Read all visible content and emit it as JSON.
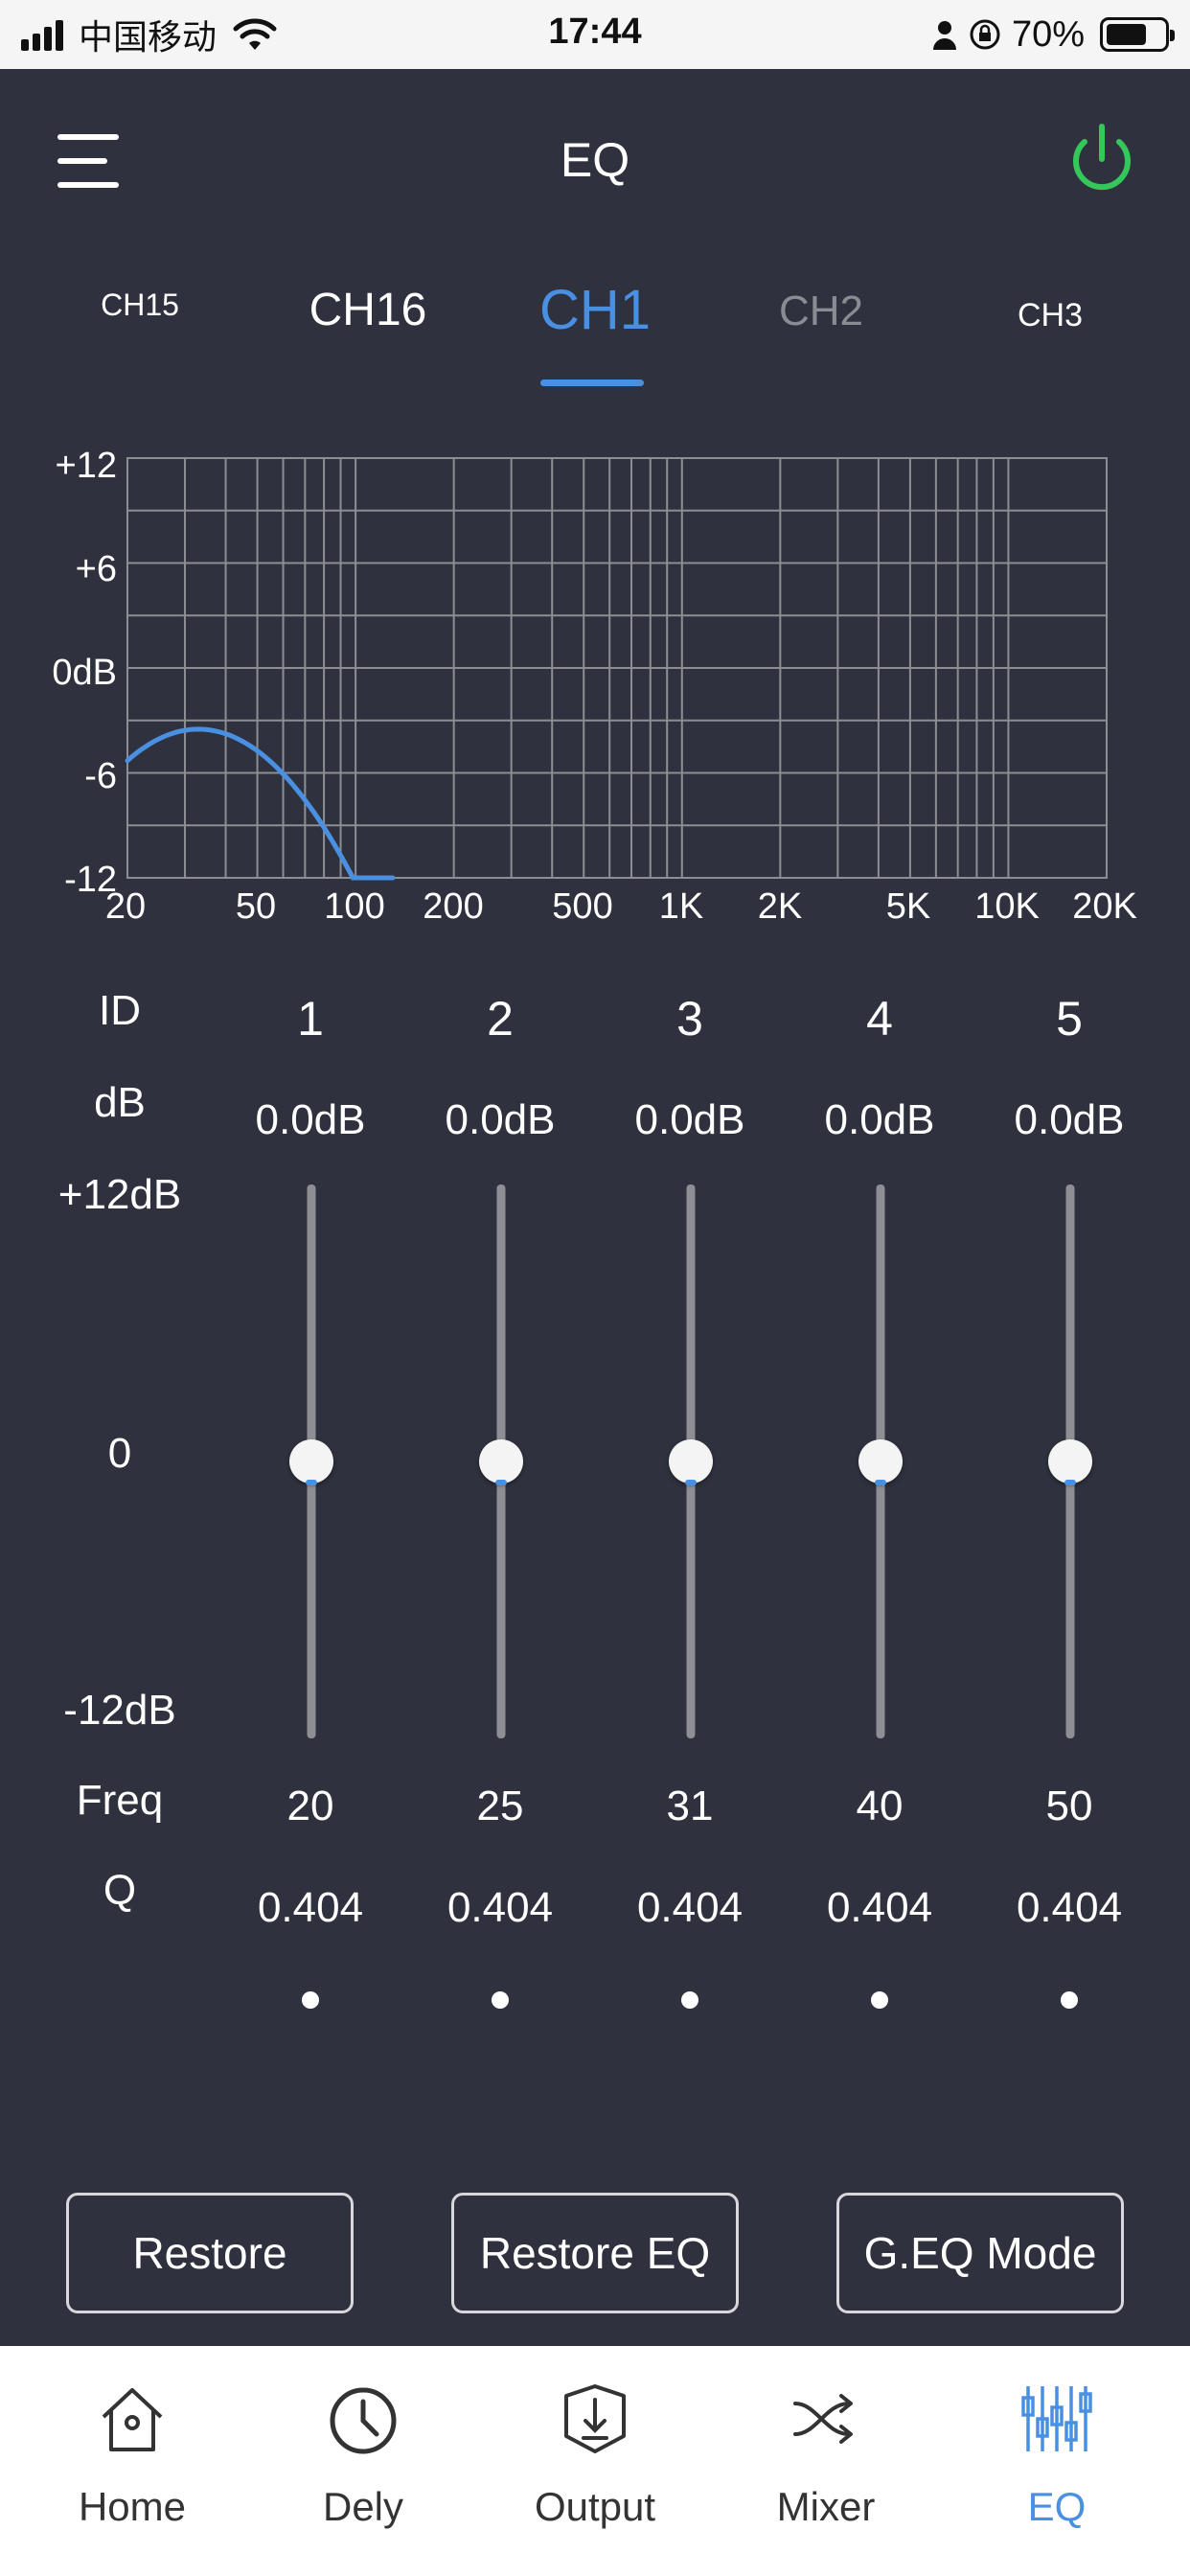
{
  "status_bar": {
    "carrier": "中国移动",
    "time": "17:44",
    "battery": "70%",
    "battery_level": 0.7,
    "signal_bars": 4
  },
  "header": {
    "title": "EQ",
    "power_on": true,
    "power_color": "#34c759",
    "menu_icon": "hamburger-menu-icon",
    "power_icon": "power-icon"
  },
  "channels": {
    "tabs": [
      "CH15",
      "CH16",
      "CH1",
      "CH2",
      "CH3"
    ],
    "selected": "CH1"
  },
  "graph": {
    "y_ticks": [
      "+12",
      "+6",
      "0dB",
      "-6",
      "-12"
    ],
    "x_ticks": [
      "20",
      "50",
      "100",
      "200",
      "500",
      "1K",
      "2K",
      "5K",
      "10K",
      "20K"
    ],
    "curve_color": "#4a90e2"
  },
  "params": {
    "row_labels": {
      "id": "ID",
      "db": "dB",
      "max": "+12dB",
      "mid": "0",
      "min": "-12dB",
      "freq": "Freq",
      "q": "Q"
    },
    "bands": [
      {
        "id": "1",
        "gain": "0.0dB",
        "gain_value": 0,
        "freq": "20",
        "q": "0.404"
      },
      {
        "id": "2",
        "gain": "0.0dB",
        "gain_value": 0,
        "freq": "25",
        "q": "0.404"
      },
      {
        "id": "3",
        "gain": "0.0dB",
        "gain_value": 0,
        "freq": "31",
        "q": "0.404"
      },
      {
        "id": "4",
        "gain": "0.0dB",
        "gain_value": 0,
        "freq": "40",
        "q": "0.404"
      },
      {
        "id": "5",
        "gain": "0.0dB",
        "gain_value": 0,
        "freq": "50",
        "q": "0.404"
      }
    ]
  },
  "actions": {
    "restore": "Restore",
    "restore_eq": "Restore EQ",
    "geq_mode": "G.EQ Mode"
  },
  "nav": {
    "items": [
      {
        "label": "Home",
        "icon": "home-icon"
      },
      {
        "label": "Dely",
        "icon": "clock-icon"
      },
      {
        "label": "Output",
        "icon": "output-icon"
      },
      {
        "label": "Mixer",
        "icon": "shuffle-icon"
      },
      {
        "label": "EQ",
        "icon": "equalizer-icon"
      }
    ],
    "active": "EQ",
    "active_color": "#4a90e2"
  }
}
